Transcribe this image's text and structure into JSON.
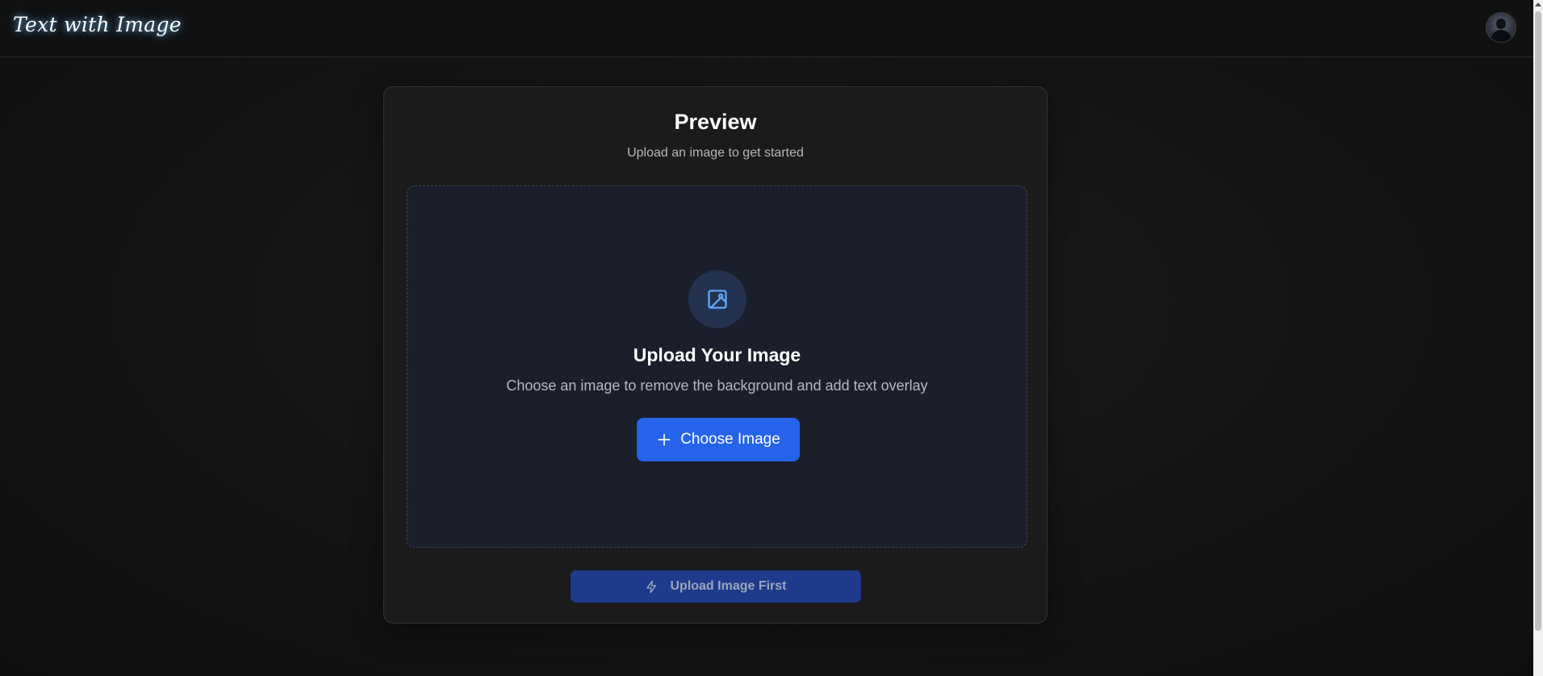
{
  "header": {
    "brand": "Text with Image",
    "avatar_icon": "user-avatar"
  },
  "card": {
    "title": "Preview",
    "subtitle": "Upload an image to get started"
  },
  "dropzone": {
    "icon": "image-icon",
    "title": "Upload Your Image",
    "description": "Choose an image to remove the background and add text overlay",
    "button_label": "Choose Image",
    "button_icon": "plus-icon"
  },
  "action": {
    "label": "Upload Image First",
    "icon": "lightning-icon",
    "disabled": true
  },
  "colors": {
    "accent": "#2563eb",
    "accent_disabled": "#1e3a8a",
    "background": "#141414",
    "card": "#1b1b1b",
    "dropzone": "#1a1f2b",
    "icon_circle": "#23324f",
    "icon_stroke": "#60a5fa"
  }
}
